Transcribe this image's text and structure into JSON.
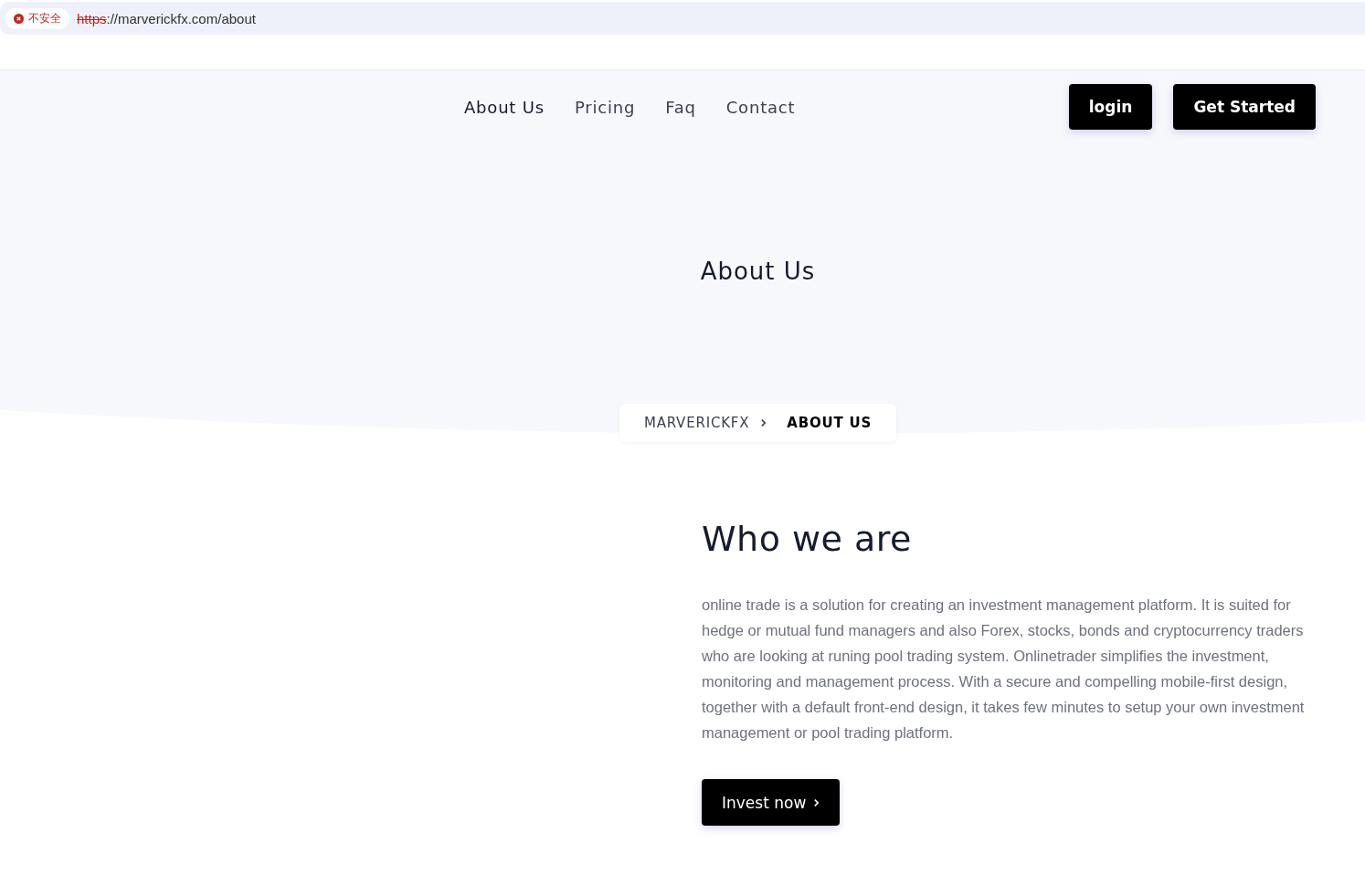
{
  "browser": {
    "security_label": "不安全",
    "url_scheme": "https",
    "url_rest": "://marverickfx.com/about"
  },
  "nav": {
    "links": [
      {
        "label": "About Us",
        "selected": true
      },
      {
        "label": "Pricing",
        "selected": false
      },
      {
        "label": "Faq",
        "selected": false
      },
      {
        "label": "Contact",
        "selected": false
      }
    ],
    "buttons": [
      "login",
      "Get Started"
    ]
  },
  "hero": {
    "title": "About Us"
  },
  "breadcrumb": [
    "MARVERICKFX",
    "ABOUT US"
  ],
  "section": {
    "heading": "Who we are",
    "paragraph": "online trade is a solution for creating an investment management platform. It is suited for hedge or mutual fund managers and also Forex, stocks, bonds and cryptocurrency traders who are looking at runing pool trading system. Onlinetrader simplifies the investment, monitoring and management process. With a secure and compelling mobile-first design, together with a default front-end design, it takes few minutes to setup your own investment management or pool trading platform.",
    "button": "Invest now"
  }
}
